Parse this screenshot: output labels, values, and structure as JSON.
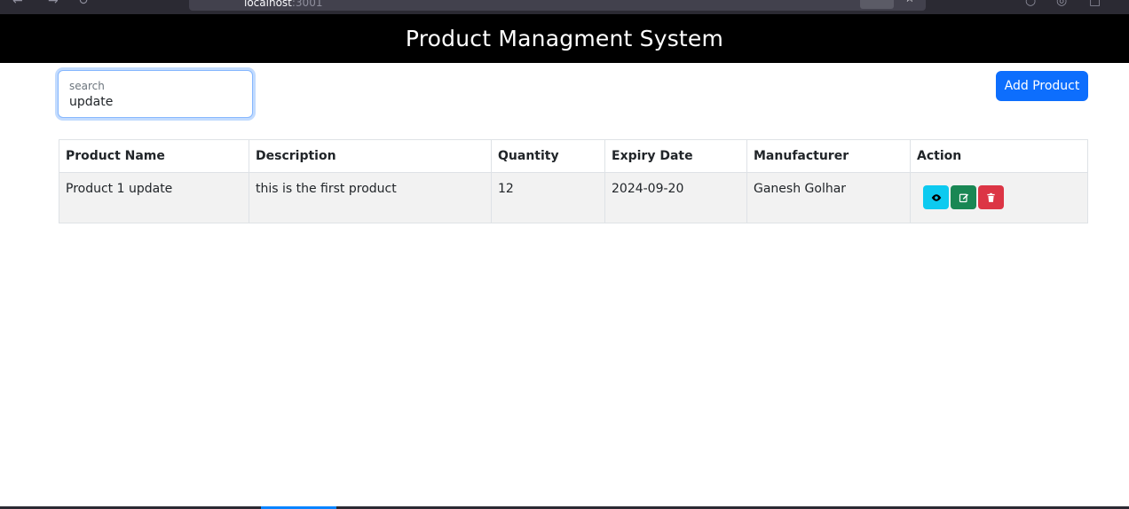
{
  "browser": {
    "url_host": "localhost",
    "url_port": ":3001"
  },
  "header": {
    "title": "Product Managment System"
  },
  "search": {
    "label": "search",
    "value": "update"
  },
  "toolbar": {
    "add_label": "Add Product"
  },
  "table": {
    "columns": [
      "Product Name",
      "Description",
      "Quantity",
      "Expiry Date",
      "Manufacturer",
      "Action"
    ],
    "rows": [
      {
        "name": "Product 1 update",
        "description": "this is the first product",
        "quantity": "12",
        "expiry": "2024-09-20",
        "manufacturer": "Ganesh Golhar",
        "actions": [
          "eye-icon",
          "edit-icon",
          "trash-icon"
        ]
      }
    ]
  },
  "colors": {
    "header_bg": "#000000",
    "primary": "#0d6efd",
    "info": "#0dcaf0",
    "success": "#198754",
    "danger": "#dc3545",
    "row_bg": "#f2f2f2"
  }
}
